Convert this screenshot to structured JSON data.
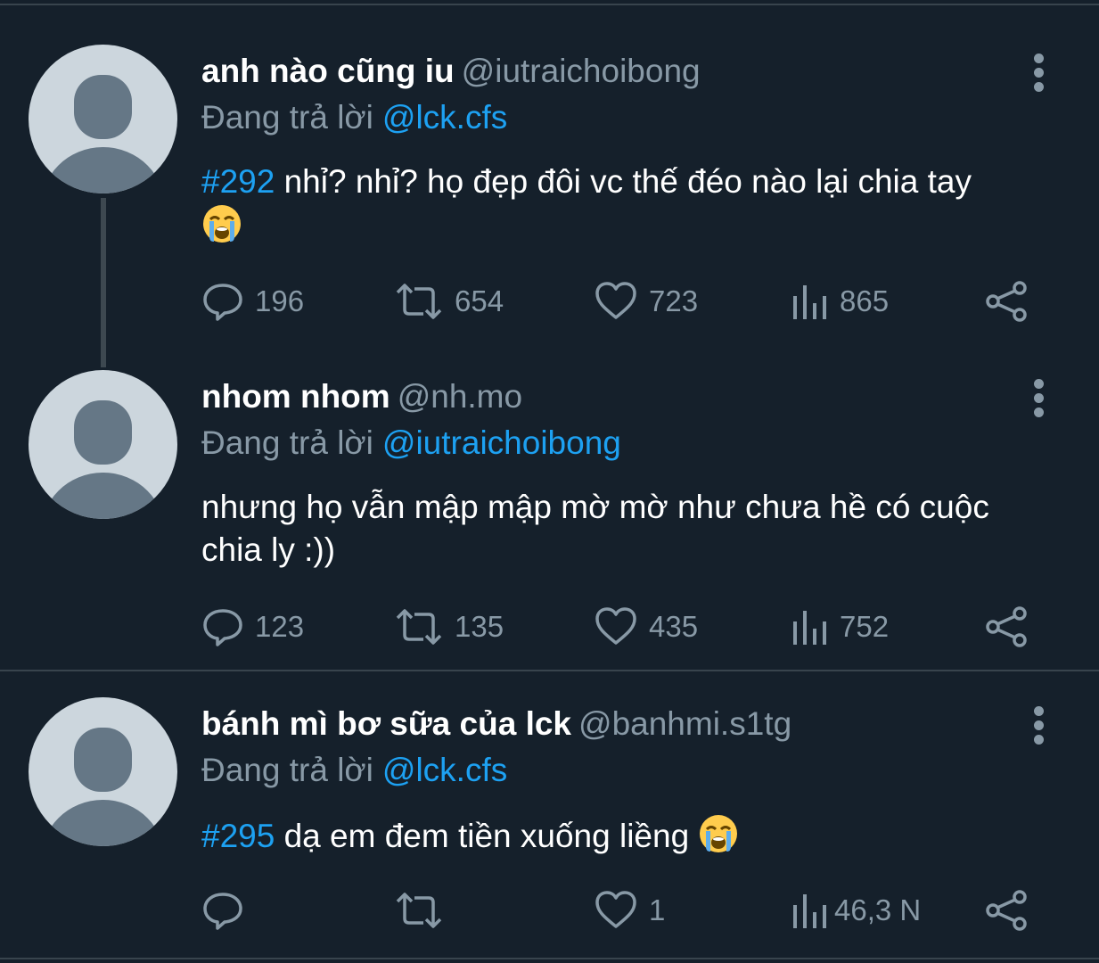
{
  "reply_prefix": "Đang trả lời",
  "tweets": [
    {
      "display_name": "anh nào cũng iu",
      "handle": "@iutraichoibong",
      "reply_to": "@lck.cfs",
      "hashtag": "#292",
      "text": " nhỉ? nhỉ? họ đẹp đôi vc thế đéo nào lại chia tay",
      "emoji": "loudly-crying-face",
      "replies": "196",
      "retweets": "654",
      "likes": "723",
      "views": "865"
    },
    {
      "display_name": "nhom nhom",
      "handle": "@nh.mo",
      "reply_to": "@iutraichoibong",
      "hashtag": "",
      "text": "nhưng họ vẫn mập mập mờ mờ như chưa hề có cuộc chia ly :))",
      "replies": "123",
      "retweets": "135",
      "likes": "435",
      "views": "752"
    },
    {
      "display_name": "bánh mì bơ sữa của lck",
      "handle": "@banhmi.s1tg",
      "reply_to": "@lck.cfs",
      "hashtag": "#295",
      "text": " dạ em đem tiền xuống liềng",
      "emoji": "loudly-crying-face",
      "replies": "",
      "retweets": "",
      "likes": "1",
      "views": "46,3 N"
    }
  ],
  "colors": {
    "background": "#15202b",
    "link": "#1da1f2",
    "secondary_text": "#8899a6",
    "divider": "#38444d"
  },
  "icons": [
    "more-vertical-icon",
    "reply-icon",
    "retweet-icon",
    "like-icon",
    "views-icon",
    "share-icon",
    "default-avatar-icon",
    "crying-emoji-icon"
  ]
}
